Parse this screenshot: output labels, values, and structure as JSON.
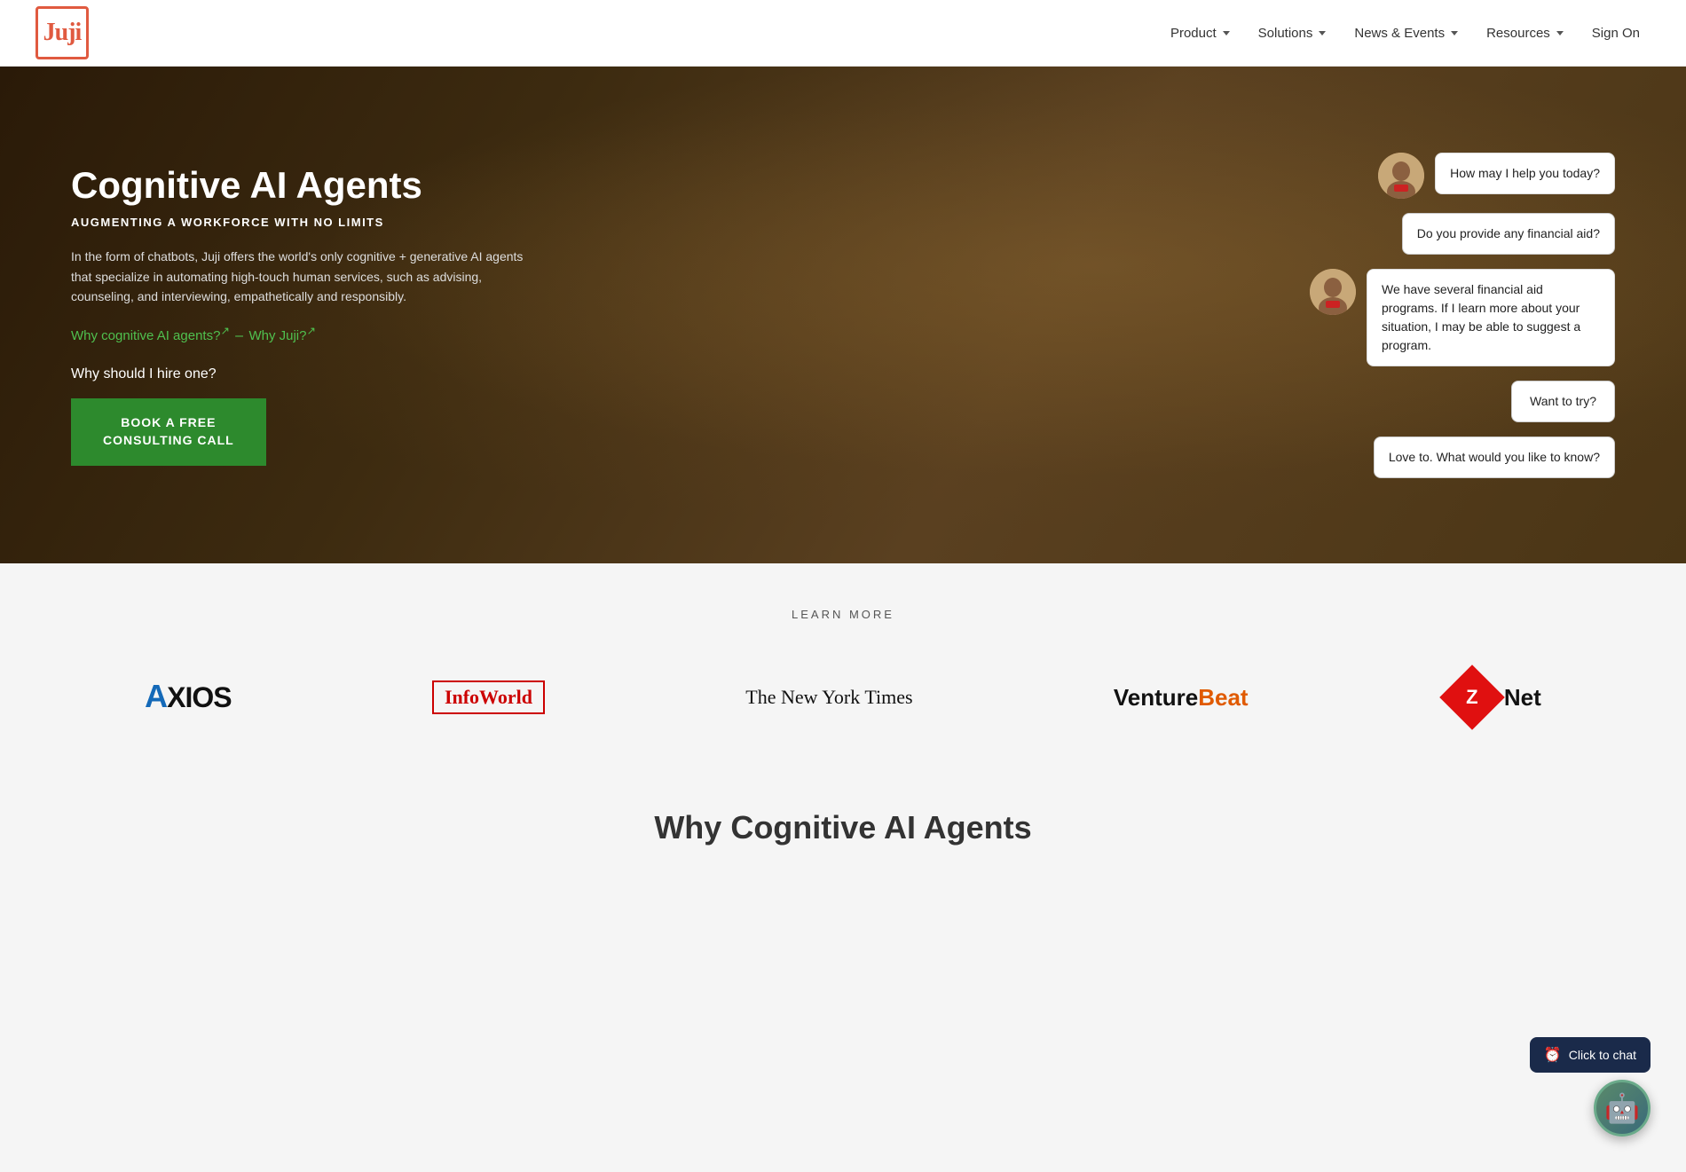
{
  "navbar": {
    "logo_text": "Juji",
    "links": [
      {
        "label": "Product",
        "has_dropdown": true
      },
      {
        "label": "Solutions",
        "has_dropdown": true
      },
      {
        "label": "News & Events",
        "has_dropdown": true
      },
      {
        "label": "Resources",
        "has_dropdown": true
      },
      {
        "label": "Sign On",
        "has_dropdown": false
      }
    ]
  },
  "hero": {
    "title": "Cognitive AI Agents",
    "subtitle": "AUGMENTING A WORKFORCE WITH NO LIMITS",
    "description": "In the form of chatbots, Juji offers the world's only cognitive + generative AI agents that specialize in automating high-touch human services, such as advising, counseling, and interviewing, empathetically and responsibly.",
    "link1_text": "Why cognitive AI agents?",
    "link1_superscript": "↗",
    "link2_text": "Why Juji?",
    "link2_superscript": "↗",
    "why_hire": "Why should I hire one?",
    "btn_line1": "BOOK A FREE",
    "btn_line2": "CONSULTING CALL",
    "chat_bubbles": [
      {
        "type": "bot",
        "text": "How may I help you today?",
        "has_avatar": true
      },
      {
        "type": "user",
        "text": "Do you provide any financial aid?",
        "has_avatar": false
      },
      {
        "type": "bot",
        "text": "We have several financial aid programs. If I learn more about your situation, I may be able to suggest a program.",
        "has_avatar": true
      },
      {
        "type": "user",
        "text": "Want to try?",
        "has_avatar": false
      },
      {
        "type": "user",
        "text": "Love to. What would you like to know?",
        "has_avatar": false
      }
    ]
  },
  "learn_more": {
    "label": "LEARN MORE"
  },
  "logos": [
    {
      "name": "Axios",
      "type": "axios"
    },
    {
      "name": "InfoWorld",
      "type": "infoworld"
    },
    {
      "name": "The New York Times",
      "type": "nyt"
    },
    {
      "name": "VentureBeat",
      "type": "venturebeat"
    },
    {
      "name": "ZDNet",
      "type": "zdnet"
    }
  ],
  "why_preview": {
    "title": "Why Cognitive AI Agents"
  },
  "chat_widget": {
    "tooltip": "Click to chat",
    "aria_label": "Open chat"
  }
}
